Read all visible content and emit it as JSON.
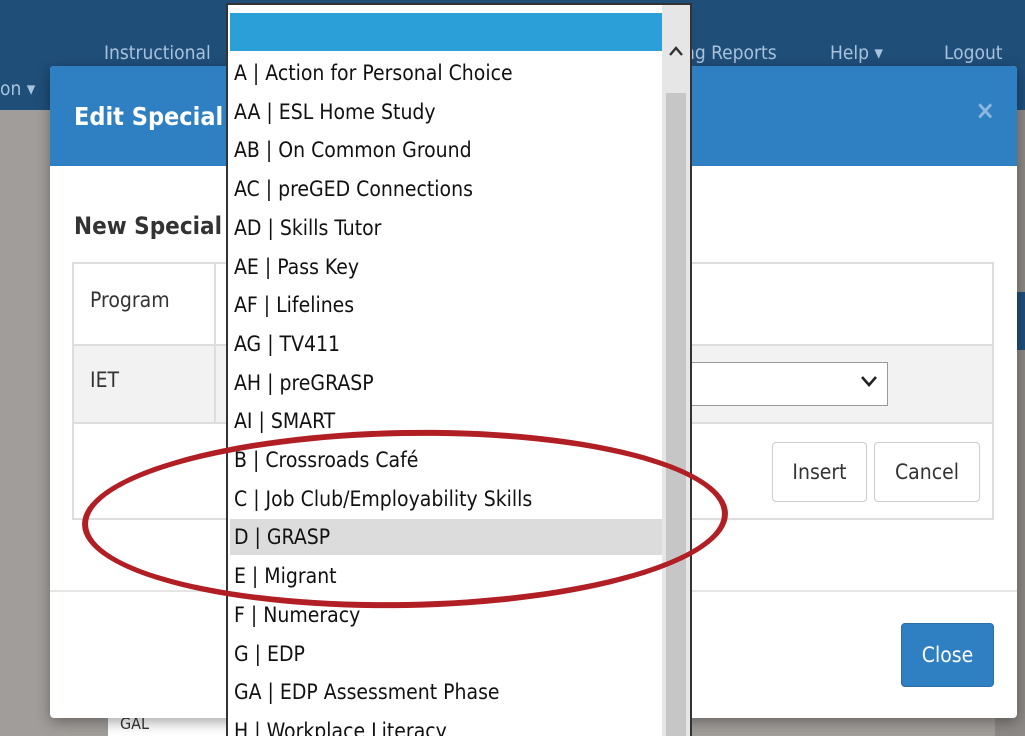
{
  "navbar": {
    "items": [
      "Instructional",
      "ng Reports",
      "Help ▾",
      "Logout"
    ],
    "left_stub": "on ▾"
  },
  "background_page": {
    "cut_text": "GAL"
  },
  "modal": {
    "title": "Edit Special",
    "close_icon": "×",
    "section_title": "New Special",
    "table": {
      "header_col1": "Program",
      "row_value": "IET"
    },
    "buttons": {
      "insert": "Insert",
      "cancel": "Cancel",
      "close": "Close"
    }
  },
  "dropdown": {
    "scroll_up_icon": "^",
    "options": [
      "A | Action for Personal Choice",
      "AA | ESL Home Study",
      "AB | On Common Ground",
      "AC | preGED Connections",
      "AD | Skills Tutor",
      "AE | Pass Key",
      "AF | Lifelines",
      "AG | TV411",
      "AH | preGRASP",
      "AI | SMART",
      "B | Crossroads Café",
      "C | Job Club/Employability Skills",
      "D | GRASP",
      "E | Migrant",
      "F | Numeracy",
      "G | EDP",
      "GA | EDP Assessment Phase",
      "H | Workplace Literacy"
    ],
    "selected_index": 12
  },
  "colors": {
    "navbar": "#1f4e79",
    "modal_header": "#2f80c2",
    "dropdown_highlight": "#2a9fd8",
    "annotation": "#b11e24"
  }
}
